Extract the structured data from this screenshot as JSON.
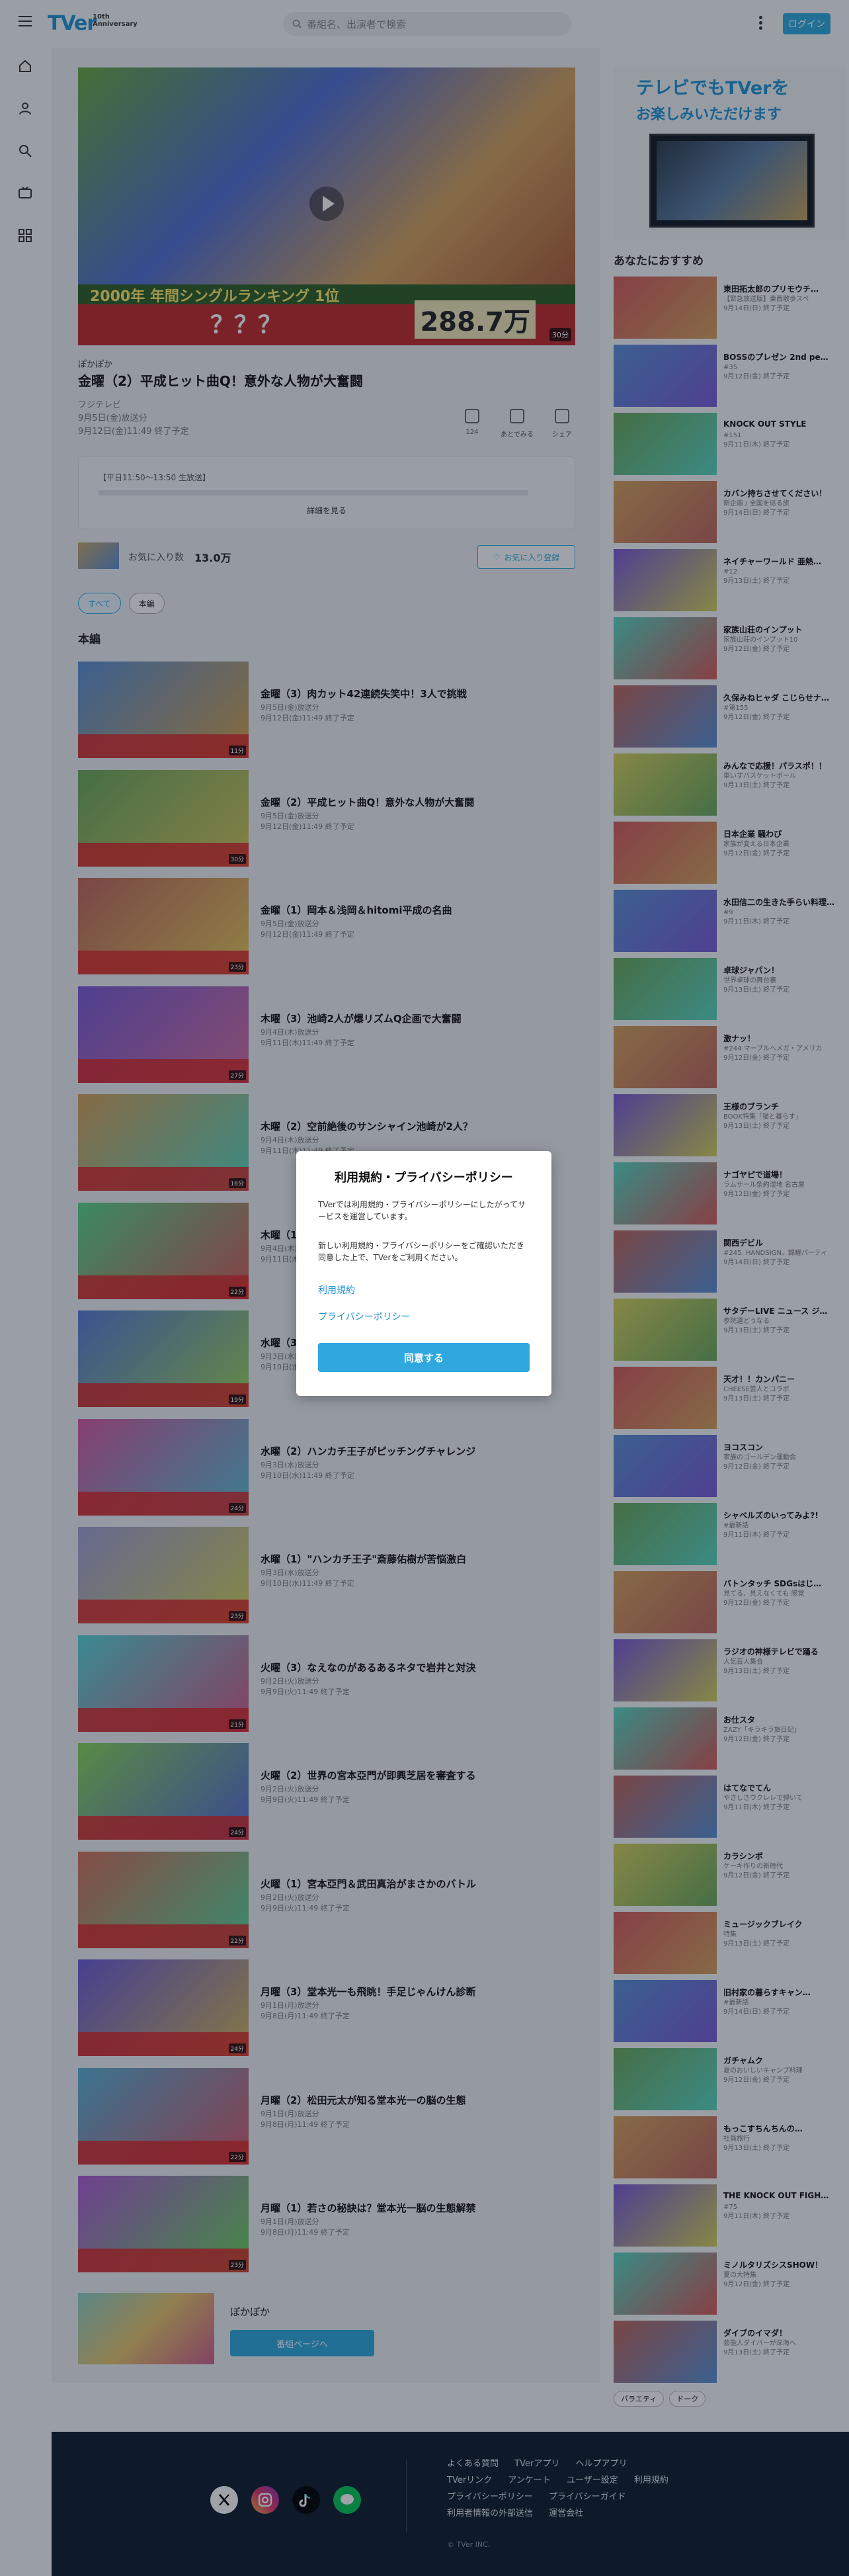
{
  "header": {
    "logo": "TVer",
    "logo_badge": "10th Anniversary",
    "search_placeholder": "番組名、出演者で検索",
    "login": "ログイン"
  },
  "player": {
    "band_text": "2000年 年間シングルランキング 1位",
    "questions": "？？？",
    "number_text": "288.7万",
    "duration": "30分"
  },
  "episode": {
    "series": "ぽかぽか",
    "title": "金曜（2）平成ヒット曲Q！意外な人物が大奮闘",
    "network": "フジテレビ",
    "aired": "9月5日(金)放送分",
    "expires": "9月12日(金)11:49 終了予定",
    "description": "【平日11:50～13:50 生放送】",
    "more": "詳細を見る",
    "actions": [
      {
        "label": "124"
      },
      {
        "label": "あとでみる"
      },
      {
        "label": "シェア"
      }
    ]
  },
  "favorites": {
    "label": "お気に入り数",
    "count": "13.0万",
    "button": "お気に入り登録"
  },
  "filters": [
    "すべて",
    "本編"
  ],
  "section_title": "本編",
  "episodes": [
    {
      "title": "金曜（3）肉カット42連続失笑中！3人で挑戦",
      "aired": "9月5日(金)放送分",
      "expires": "9月12日(金)11:49 終了予定",
      "duration": "11分"
    },
    {
      "title": "金曜（2）平成ヒット曲Q！意外な人物が大奮闘",
      "aired": "9月5日(金)放送分",
      "expires": "9月12日(金)11:49 終了予定",
      "duration": "30分"
    },
    {
      "title": "金曜（1）岡本＆浅岡＆hitomi平成の名曲",
      "aired": "9月5日(金)放送分",
      "expires": "9月12日(金)11:49 終了予定",
      "duration": "23分"
    },
    {
      "title": "木曜（3）池崎2人が爆リズムQ企画で大奮闘",
      "aired": "9月4日(木)放送分",
      "expires": "9月11日(木)11:49 終了予定",
      "duration": "27分"
    },
    {
      "title": "木曜（2）空前絶後のサンシャイン池崎が2人？",
      "aired": "9月4日(木)放送分",
      "expires": "9月11日(木)11:49 終了予定",
      "duration": "16分"
    },
    {
      "title": "木曜（1）",
      "aired": "9月4日(木)放送分",
      "expires": "9月11日(木)11:49 終了予定",
      "duration": "22分"
    },
    {
      "title": "水曜（3）",
      "aired": "9月3日(水)放送分",
      "expires": "9月10日(水)11:49 終了予定",
      "duration": "19分"
    },
    {
      "title": "水曜（2）ハンカチ王子がピッチングチャレンジ",
      "aired": "9月3日(水)放送分",
      "expires": "9月10日(水)11:49 終了予定",
      "duration": "24分"
    },
    {
      "title": "水曜（1）\"ハンカチ王子\"斎藤佑樹が苦悩激白",
      "aired": "9月3日(水)放送分",
      "expires": "9月10日(水)11:49 終了予定",
      "duration": "23分"
    },
    {
      "title": "火曜（3）なえなのがあるあるネタで岩井と対決",
      "aired": "9月2日(火)放送分",
      "expires": "9月9日(火)11:49 終了予定",
      "duration": "21分"
    },
    {
      "title": "火曜（2）世界の宮本亞門が即興芝居を審査する",
      "aired": "9月2日(火)放送分",
      "expires": "9月9日(火)11:49 終了予定",
      "duration": "24分"
    },
    {
      "title": "火曜（1）宮本亞門＆武田真治がまさかのバトル",
      "aired": "9月2日(火)放送分",
      "expires": "9月9日(火)11:49 終了予定",
      "duration": "22分"
    },
    {
      "title": "月曜（3）堂本光一も飛眺！手足じゃんけん診断",
      "aired": "9月1日(月)放送分",
      "expires": "9月8日(月)11:49 終了予定",
      "duration": "24分"
    },
    {
      "title": "月曜（2）松田元太が知る堂本光一の脳の生態",
      "aired": "9月1日(月)放送分",
      "expires": "9月8日(月)11:49 終了予定",
      "duration": "22分"
    },
    {
      "title": "月曜（1）若さの秘訣は？堂本光一脳の生態解禁",
      "aired": "9月1日(月)放送分",
      "expires": "9月8日(月)11:49 終了予定",
      "duration": "23分"
    }
  ],
  "series_card": {
    "name": "ぽかぽか",
    "button": "番組ページへ"
  },
  "promo": {
    "line1": "テレビでもTVerを",
    "line2": "お楽しみいただけます"
  },
  "recommend_title": "あなたにおすすめ",
  "recommendations": [
    {
      "title": "東田拓太郎のプリモウチ…",
      "desc": "【緊急放送版】東西散歩スペ",
      "expires": "9月14日(日) 終了予定"
    },
    {
      "title": "BOSSのプレゼン 2nd pe…",
      "desc": "#35",
      "expires": "9月12日(金) 終了予定"
    },
    {
      "title": "KNOCK OUT STYLE",
      "desc": "#151",
      "expires": "9月11日(木) 終了予定"
    },
    {
      "title": "カバン持ちさせてください！",
      "desc": "新企画 / 全国を巡る旅",
      "expires": "9月14日(日) 終了予定"
    },
    {
      "title": "ネイチャーワールド 亜熱…",
      "desc": "#12",
      "expires": "9月13日(土) 終了予定"
    },
    {
      "title": "家族山荘のインプット",
      "desc": "家族山荘のインプット10",
      "expires": "9月12日(金) 終了予定"
    },
    {
      "title": "久保みねヒャダ こじらせナ…",
      "desc": "#第155",
      "expires": "9月12日(金) 終了予定"
    },
    {
      "title": "みんなで応援！パラスポ！！",
      "desc": "車いすバスケットボール",
      "expires": "9月13日(土) 終了予定"
    },
    {
      "title": "日本企業 騒わぴ",
      "desc": "家族が変える日本企業",
      "expires": "9月12日(金) 終了予定"
    },
    {
      "title": "水田信二の生きた手らい料理…",
      "desc": "#9",
      "expires": "9月11日(木) 終了予定"
    },
    {
      "title": "卓球ジャパン！",
      "desc": "世界卓球の舞台裏",
      "expires": "9月13日(土) 終了予定"
    },
    {
      "title": "激ナッ！",
      "desc": "#244 マーブルへメガ・アメリカ",
      "expires": "9月12日(金) 終了予定"
    },
    {
      "title": "王様のブランチ",
      "desc": "BOOK特集「猫と暮らす」",
      "expires": "9月13日(土) 終了予定"
    },
    {
      "title": "ナゴヤピで道場！",
      "desc": "ラムサール条約湿地 名古屋",
      "expires": "9月12日(金) 終了予定"
    },
    {
      "title": "関西デビル",
      "desc": "#245. HANDSIGN、錦鯉パーティ",
      "expires": "9月14日(日) 終了予定"
    },
    {
      "title": "サタデーLIVE ニュース ジ…",
      "desc": "参院選どうなる",
      "expires": "9月13日(土) 終了予定"
    },
    {
      "title": "天才！！カンパニー",
      "desc": "CHEESE芸人とコラボ",
      "expires": "9月13日(土) 終了予定"
    },
    {
      "title": "ヨコスコン",
      "desc": "家族のゴールデン運動会",
      "expires": "9月12日(金) 終了予定"
    },
    {
      "title": "シャベルズのいってみよ?!",
      "desc": "#最新話",
      "expires": "9月11日(木) 終了予定"
    },
    {
      "title": "バトンタッチ SDGsはじ…",
      "desc": "見てる、見えなくても 感覚",
      "expires": "9月12日(金) 終了予定"
    },
    {
      "title": "ラジオの神様テレビで踊る",
      "desc": "人気芸人集合",
      "expires": "9月13日(土) 終了予定"
    },
    {
      "title": "お仕スタ",
      "desc": "ZAZY「キラキラ旅日記」",
      "expires": "9月12日(金) 終了予定"
    },
    {
      "title": "はてなでてん",
      "desc": "やさしさウクレレで弾いて",
      "expires": "9月11日(木) 終了予定"
    },
    {
      "title": "カラシンボ",
      "desc": "ケーキ作りの新時代",
      "expires": "9月12日(金) 終了予定"
    },
    {
      "title": "ミュージックブレイク",
      "desc": "特集",
      "expires": "9月13日(土) 終了予定"
    },
    {
      "title": "旧村家の暮らすキャン…",
      "desc": "#最新話",
      "expires": "9月14日(日) 終了予定"
    },
    {
      "title": "ガチャムク",
      "desc": "夏のおいしいキャンプ料理",
      "expires": "9月12日(金) 終了予定"
    },
    {
      "title": "もっこすちんちんの…",
      "desc": "社員旅行",
      "expires": "9月13日(土) 終了予定"
    },
    {
      "title": "THE KNOCK OUT FIGH…",
      "desc": "#75",
      "expires": "9月11日(木) 終了予定"
    },
    {
      "title": "ミノルタリズシスSHOW！",
      "desc": "夏の大特集",
      "expires": "9月12日(金) 終了予定"
    },
    {
      "title": "ダイブのイマダ！",
      "desc": "芸能人ダイバーが深海へ",
      "expires": "9月13日(土) 終了予定"
    }
  ],
  "languages": [
    "パラエティ",
    "ドーク"
  ],
  "footer": {
    "links": [
      "よくある質問",
      "TVerアプリ",
      "ヘルプアプリ",
      "TVerリンク",
      "アンケート",
      "ユーザー設定",
      "利用規約",
      "プライバシーポリシー",
      "プライバシーガイド",
      "利用者情報の外部送信",
      "運営会社"
    ],
    "copyright": "© TVer INC."
  },
  "modal": {
    "title": "利用規約・プライバシーポリシー",
    "para1": "TVerでは利用規約・プライバシーポリシーにしたがってサービスを運営しています。",
    "para2": "新しい利用規約・プライバシーポリシーをご確認いただき同意した上で、TVerをご利用ください。",
    "link_terms": "利用規約",
    "link_privacy": "プライバシーポリシー",
    "agree": "同意する"
  },
  "colors": {
    "accent": "#2fa8e0",
    "brand": "#1f93d5",
    "footer_bg": "#0e1a2b"
  }
}
